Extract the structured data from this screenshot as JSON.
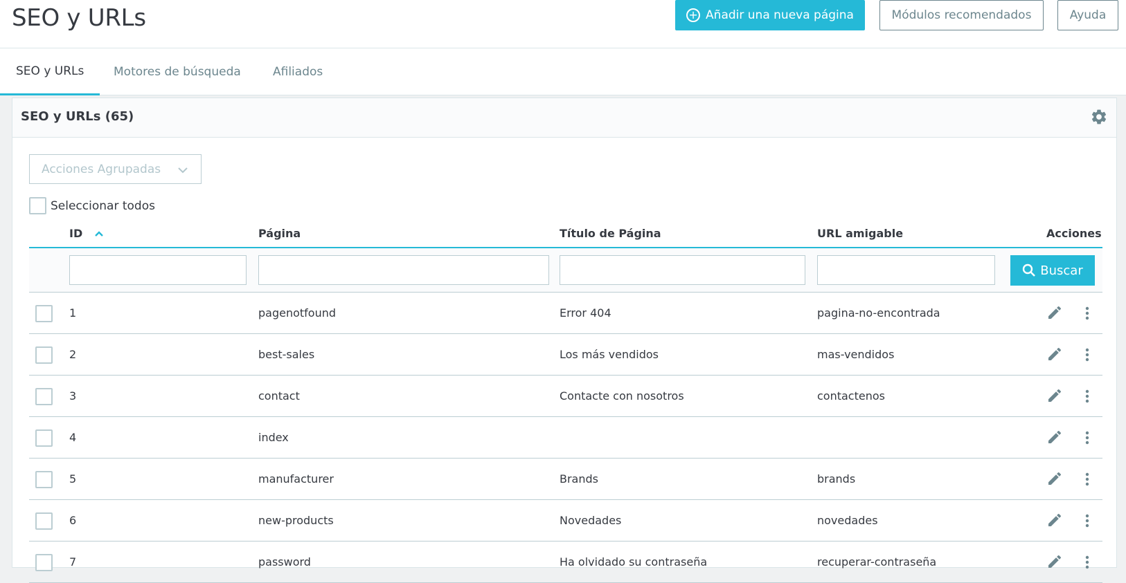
{
  "header": {
    "title": "SEO y URLs",
    "add_button": "Añadir una nueva página",
    "modules_button": "Módulos recomendados",
    "help_button": "Ayuda"
  },
  "tabs": [
    {
      "label": "SEO y URLs",
      "active": true
    },
    {
      "label": "Motores de búsqueda",
      "active": false
    },
    {
      "label": "Afiliados",
      "active": false
    }
  ],
  "card": {
    "title": "SEO y URLs (65)",
    "bulk_actions": "Acciones Agrupadas",
    "select_all": "Seleccionar todos",
    "search_button": "Buscar"
  },
  "columns": {
    "id": "ID",
    "page": "Página",
    "title": "Título de Página",
    "url": "URL amigable",
    "actions": "Acciones"
  },
  "rows": [
    {
      "id": "1",
      "page": "pagenotfound",
      "title": "Error 404",
      "url": "pagina-no-encontrada"
    },
    {
      "id": "2",
      "page": "best-sales",
      "title": "Los más vendidos",
      "url": "mas-vendidos"
    },
    {
      "id": "3",
      "page": "contact",
      "title": "Contacte con nosotros",
      "url": "contactenos"
    },
    {
      "id": "4",
      "page": "index",
      "title": "",
      "url": ""
    },
    {
      "id": "5",
      "page": "manufacturer",
      "title": "Brands",
      "url": "brands"
    },
    {
      "id": "6",
      "page": "new-products",
      "title": "Novedades",
      "url": "novedades"
    },
    {
      "id": "7",
      "page": "password",
      "title": "Ha olvidado su contraseña",
      "url": "recuperar-contraseña"
    }
  ],
  "colors": {
    "accent": "#25b9d7",
    "text": "#363a41",
    "muted": "#6c868e"
  }
}
